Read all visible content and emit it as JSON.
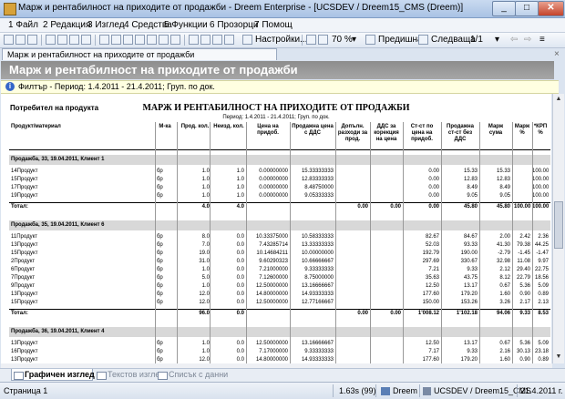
{
  "window": {
    "title": "Марж и рентабилност на приходите от продажби - Dreem Enterprise - [UCSDEV / Dreem15_CMS (Dreem)]",
    "minimize": "_",
    "maximize": "□",
    "close": "✕"
  },
  "menu": {
    "items": [
      "1 Файл",
      "2 Редакция",
      "3 Изглед",
      "4 Средства",
      "5 Функции",
      "6 Прозорци",
      "7 Помощ"
    ]
  },
  "toolbar": {
    "settings": "Настройки...",
    "zoom": "70 %",
    "prev": "Предишна",
    "next": "Следваща",
    "page": "1/1"
  },
  "document_tab": {
    "label": "Марж и рентабилност на приходите от продажби",
    "close": "×"
  },
  "banner": {
    "title": "Марж и рентабилност на приходите от продажби"
  },
  "filter": {
    "text": "Филтър - Период: 1.4.2011 - 21.4.2011; Груп. по док."
  },
  "report": {
    "left_header": "Потребител на продукта",
    "title": "МАРЖ И РЕНТАБИЛНОСТ НА ПРИХОДИТЕ ОТ ПРОДАЖБИ",
    "period": "Период: 1.4.2011 - 21.4.2011; Груп. по док.",
    "columns": [
      "Продукт/материал",
      "М-ка",
      "Прод. кол.",
      "Неизд. кол.",
      "Цена на придоб.",
      "Продажна цена с ДДС",
      "Допълн. разходи за прод.",
      "ДДС за корекция на цена",
      "Ст-ст по цена на придоб.",
      "Продажна ст-ст без ДДС",
      "Марж сума",
      "Марж %",
      "*КРП %"
    ],
    "groups": [
      {
        "title": "Продажба, 33, 19.04.2011, Клиент 1",
        "rows": [
          [
            "14Продукт",
            "бр",
            "1.0",
            "1.0",
            "0.00000000",
            "15.33333333",
            "",
            "",
            "0.00",
            "15.33",
            "15.33",
            "",
            "100.00"
          ],
          [
            "15Продукт",
            "бр",
            "1.0",
            "1.0",
            "0.00000000",
            "12.83333333",
            "",
            "",
            "0.00",
            "12.83",
            "12.83",
            "",
            "100.00"
          ],
          [
            "17Продукт",
            "бр",
            "1.0",
            "1.0",
            "0.00000000",
            "8.48750000",
            "",
            "",
            "0.00",
            "8.49",
            "8.49",
            "",
            "100.00"
          ],
          [
            "19Продукт",
            "бр",
            "1.0",
            "1.0",
            "0.00000000",
            "9.05333333",
            "",
            "",
            "0.00",
            "9.05",
            "9.05",
            "",
            "100.00"
          ]
        ],
        "total": [
          "Тотал:",
          "",
          "4.0",
          "4.0",
          "",
          "",
          "0.00",
          "0.00",
          "0.00",
          "45.80",
          "45.80",
          "100.00",
          "100.00"
        ]
      },
      {
        "title": "Продажба, 35, 19.04.2011, Клиент 6",
        "rows": [
          [
            "11Продукт",
            "бр",
            "8.0",
            "0.0",
            "10.33375000",
            "10.58333333",
            "",
            "",
            "82.67",
            "84.67",
            "2.00",
            "2.42",
            "2.36"
          ],
          [
            "13Продукт",
            "бр",
            "7.0",
            "0.0",
            "7.43285714",
            "13.33333333",
            "",
            "",
            "52.03",
            "93.33",
            "41.30",
            "79.38",
            "44.25"
          ],
          [
            "15Продукт",
            "бр",
            "19.0",
            "0.0",
            "10.14684211",
            "10.00000000",
            "",
            "",
            "192.79",
            "190.00",
            "-2.79",
            "-1.45",
            "-1.47"
          ],
          [
            "2Продукт",
            "бр",
            "31.0",
            "0.0",
            "9.60290323",
            "10.66666667",
            "",
            "",
            "297.69",
            "330.67",
            "32.98",
            "11.08",
            "9.97"
          ],
          [
            "6Продукт",
            "бр",
            "1.0",
            "0.0",
            "7.21000000",
            "9.33333333",
            "",
            "",
            "7.21",
            "9.33",
            "2.12",
            "29.40",
            "22.75"
          ],
          [
            "7Продукт",
            "бр",
            "5.0",
            "0.0",
            "7.12600000",
            "8.75000000",
            "",
            "",
            "35.63",
            "43.75",
            "8.12",
            "22.79",
            "18.56"
          ],
          [
            "9Продукт",
            "бр",
            "1.0",
            "0.0",
            "12.50000000",
            "13.16666667",
            "",
            "",
            "12.50",
            "13.17",
            "0.67",
            "5.36",
            "5.09"
          ],
          [
            "13Продукт",
            "бр",
            "12.0",
            "0.0",
            "14.80000000",
            "14.93333333",
            "",
            "",
            "177.60",
            "179.20",
            "1.60",
            "0.90",
            "0.89"
          ],
          [
            "15Продукт",
            "бр",
            "12.0",
            "0.0",
            "12.50000000",
            "12.77166667",
            "",
            "",
            "150.00",
            "153.26",
            "3.26",
            "2.17",
            "2.13"
          ]
        ],
        "total": [
          "Тотал:",
          "",
          "96.0",
          "0.0",
          "",
          "",
          "0.00",
          "0.00",
          "1'008.12",
          "1'102.18",
          "94.06",
          "9.33",
          "8.53"
        ]
      },
      {
        "title": "Продажба, 36, 19.04.2011, Клиент 4",
        "rows": [
          [
            "13Продукт",
            "бр",
            "1.0",
            "0.0",
            "12.50000000",
            "13.16666667",
            "",
            "",
            "12.50",
            "13.17",
            "0.67",
            "5.36",
            "5.09"
          ],
          [
            "16Продукт",
            "бр",
            "1.0",
            "0.0",
            "7.17000000",
            "9.33333333",
            "",
            "",
            "7.17",
            "9.33",
            "2.16",
            "30.13",
            "23.18"
          ],
          [
            "13Продукт",
            "бр",
            "12.0",
            "0.0",
            "14.80000000",
            "14.93333333",
            "",
            "",
            "177.60",
            "179.20",
            "1.60",
            "0.90",
            "0.89"
          ]
        ]
      }
    ]
  },
  "bottom_tabs": [
    "Графичен изглед",
    "Текстов изглед",
    "Списък с данни"
  ],
  "status": {
    "page": "Страница 1",
    "time": "1.63s (99)",
    "user": "Dreem",
    "db": "UCSDEV / Dreem15_CMS",
    "date": "21.4.2011 г."
  }
}
